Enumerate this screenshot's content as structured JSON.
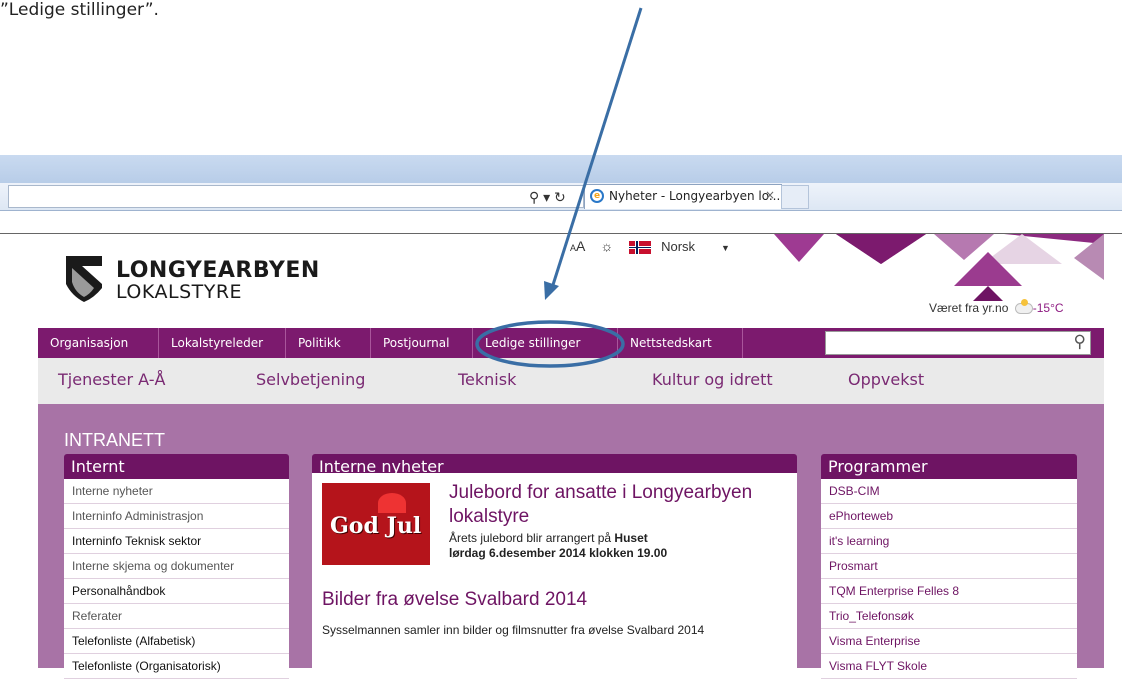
{
  "caption": "”Ledige stillinger”.",
  "browser": {
    "tab_title": "Nyheter - Longyearbyen lo...",
    "tab_close": "×",
    "address_icons": "⚲ ▾ ↻"
  },
  "site": {
    "logo_line1": "LONGYEARBYEN",
    "logo_line2": "LOKALSTYRE",
    "text_size_small": "A",
    "text_size_big": "A",
    "contrast_icon": "☼",
    "language": "Norsk",
    "weather_label": "Været fra yr.no",
    "weather_temp": "-15°C",
    "top_nav": [
      "Organisasjon",
      "Lokalstyreleder",
      "Politikk",
      "Postjournal",
      "Ledige stillinger",
      "Nettstedskart"
    ],
    "search_icon": "⚲",
    "sub_nav": [
      "Tjenester A-Å",
      "Selvbetjening",
      "Teknisk",
      "Kultur og idrett",
      "Oppvekst"
    ],
    "intranet_title": "INTRANETT",
    "internt": {
      "title": "Internt",
      "items": [
        "Interne nyheter",
        "Interninfo Administrasjon",
        "Interninfo Teknisk sektor",
        "Interne skjema og dokumenter",
        "Personalhåndbok",
        "Referater",
        "Telefonliste (Alfabetisk)",
        "Telefonliste (Organisatorisk)"
      ]
    },
    "news": {
      "title": "Interne nyheter",
      "image_text": "God Jul",
      "item1_title": "Julebord for ansatte i Longyearbyen lokalstyre",
      "item1_body_prefix": "Årets julebord blir arrangert på ",
      "item1_body_bold1": "Huset",
      "item1_body_bold2": "lørdag 6.desember 2014 klokken 19.00",
      "item2_title": "Bilder fra øvelse Svalbard 2014",
      "item2_body": "Sysselmannen samler inn bilder og filmsnutter fra øvelse Svalbard 2014"
    },
    "programmer": {
      "title": "Programmer",
      "items": [
        "DSB-CIM",
        "ePhorteweb",
        "it's learning",
        "Prosmart",
        "TQM Enterprise Felles 8",
        "Trio_Telefonsøk",
        "Visma Enterprise",
        "Visma FLYT Skole"
      ]
    }
  },
  "colors": {
    "brand_purple": "#7c1a6e",
    "panel_purple": "#6e1463",
    "background_purple": "#a873a6",
    "annotation_blue": "#3a6ea5"
  }
}
